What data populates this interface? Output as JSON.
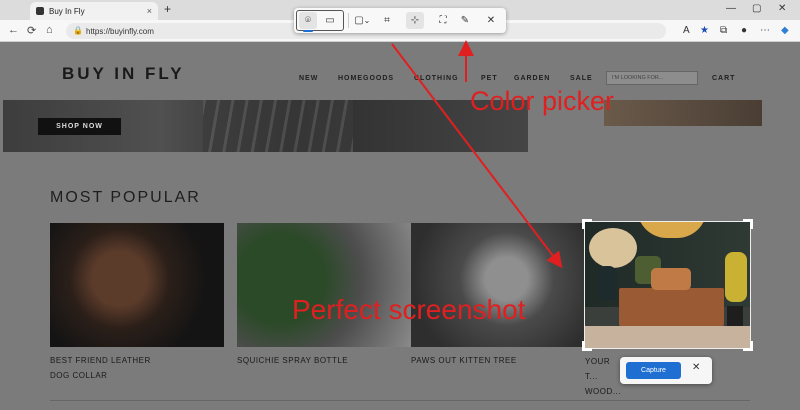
{
  "browser": {
    "tab_title": "Buy In Fly",
    "tab_close": "×",
    "new_tab": "+",
    "url": "https://buyinfly.com",
    "window_controls": [
      "—",
      "▢",
      "✕"
    ]
  },
  "site": {
    "logo": "BUY IN FLY",
    "nav": [
      "NEW",
      "HOMEGOODS",
      "CLOTHING",
      "PET",
      "GARDEN",
      "SALE"
    ],
    "search_placeholder": "I'M LOOKING FOR...",
    "cart": "CART",
    "shop_now": "SHOP NOW",
    "section_title": "MOST POPULAR",
    "products": [
      {
        "name": "BEST FRIEND LEATHER DOG COLLAR"
      },
      {
        "name": "SQUICHIE SPRAY BOTTLE"
      },
      {
        "name": "PAWS OUT KITTEN TREE"
      },
      {
        "name": "YOUR T... WOOD..."
      }
    ]
  },
  "snip_toolbar": {
    "buttons": [
      {
        "icon": "camera-icon",
        "glyph": "⌾"
      },
      {
        "icon": "video-icon",
        "glyph": "▭"
      },
      {
        "icon": "rectangle-mode-icon",
        "glyph": "▢"
      },
      {
        "icon": "crop-icon",
        "glyph": "⌗"
      },
      {
        "icon": "color-picker-icon",
        "glyph": "⊹"
      },
      {
        "icon": "text-extract-icon",
        "glyph": "⛶"
      },
      {
        "icon": "pen-icon",
        "glyph": "✎"
      },
      {
        "icon": "close-icon",
        "glyph": "✕"
      }
    ],
    "dropdown_glyph": "⌄"
  },
  "capture": {
    "button_label": "Capture",
    "close": "✕"
  },
  "annotations": {
    "color_picker": "Color picker",
    "perfect_screenshot": "Perfect screenshot",
    "color": "#e02020"
  }
}
